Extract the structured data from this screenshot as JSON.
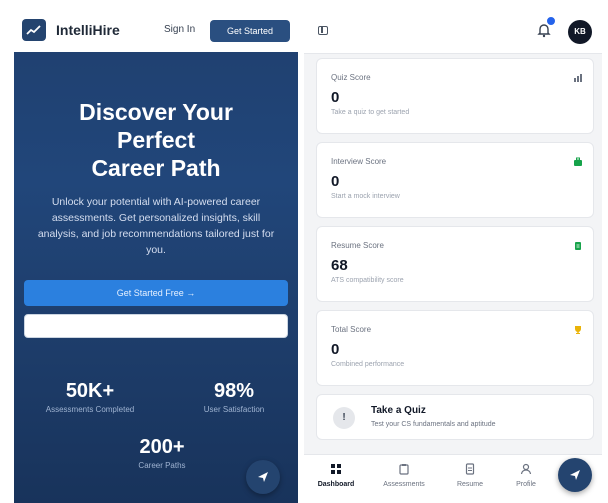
{
  "landing": {
    "brand": "IntelliHire",
    "sign_in": "Sign In",
    "get_started": "Get Started",
    "hero_line1": "Discover Your",
    "hero_line2": "Perfect",
    "hero_line3": "Career Path",
    "subtitle": "Unlock your potential with AI-powered career assessments. Get personalized insights, skill analysis, and job recommendations tailored just for you.",
    "cta_label": "Get Started Free →",
    "input_placeholder": "",
    "stats": [
      {
        "value": "50K+",
        "label": "Assessments Completed"
      },
      {
        "value": "98%",
        "label": "User Satisfaction"
      },
      {
        "value": "200+",
        "label": "Career Paths"
      }
    ]
  },
  "dashboard": {
    "avatar_initials": "KB",
    "cards": [
      {
        "title": "Quiz Score",
        "value": "0",
        "subtitle": "Take a quiz to get started",
        "icon": "chart-icon",
        "icon_color": "#6b7280"
      },
      {
        "title": "Interview Score",
        "value": "0",
        "subtitle": "Start a mock interview",
        "icon": "briefcase-icon",
        "icon_color": "#16a34a"
      },
      {
        "title": "Resume Score",
        "value": "68",
        "subtitle": "ATS compatibility score",
        "icon": "document-icon",
        "icon_color": "#16a34a"
      },
      {
        "title": "Total Score",
        "value": "0",
        "subtitle": "Combined performance",
        "icon": "trophy-icon",
        "icon_color": "#eab308"
      }
    ],
    "quiz_action": {
      "title": "Take a Quiz",
      "subtitle": "Test your CS fundamentals and aptitude"
    },
    "nav": [
      {
        "label": "Dashboard",
        "icon": "grid-icon"
      },
      {
        "label": "Assessments",
        "icon": "clipboard-icon"
      },
      {
        "label": "Resume",
        "icon": "file-icon"
      },
      {
        "label": "Profile",
        "icon": "user-icon"
      }
    ]
  },
  "colors": {
    "navy": "#24446f",
    "cta_blue": "#2b80df",
    "notification_blue": "#2563eb"
  }
}
